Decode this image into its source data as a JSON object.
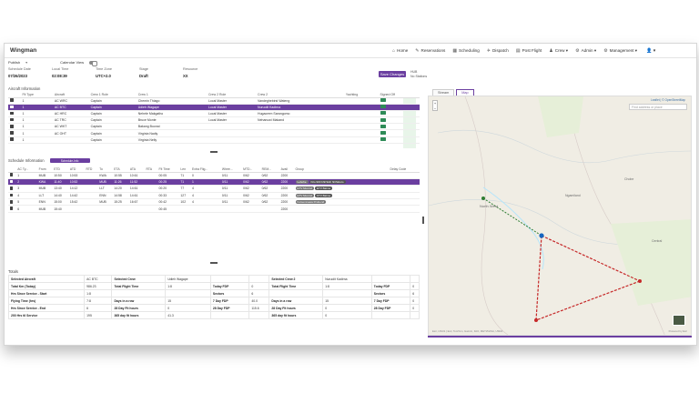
{
  "app": {
    "title": "Wingman"
  },
  "nav": [
    {
      "label": "Home",
      "icon": "home-icon",
      "glyph": "⌂"
    },
    {
      "label": "Reservations",
      "icon": "reservations-icon",
      "glyph": "✎"
    },
    {
      "label": "Scheduling",
      "icon": "scheduling-icon",
      "glyph": "▦"
    },
    {
      "label": "Dispatch",
      "icon": "dispatch-icon",
      "glyph": "✈"
    },
    {
      "label": "Post Flight",
      "icon": "post-flight-icon",
      "glyph": "▤"
    },
    {
      "label": "Crew ▾",
      "icon": "crew-icon",
      "glyph": "♟"
    },
    {
      "label": "Admin ▾",
      "icon": "admin-icon",
      "glyph": "⚙"
    },
    {
      "label": "Management ▾",
      "icon": "management-icon",
      "glyph": "⚙"
    }
  ],
  "user_icon": "👤 ▾",
  "toolbar": {
    "publish_label": "Publish",
    "calendar_view_label": "Calendar View"
  },
  "fields": [
    {
      "label": "Schedule Date",
      "value": "07/26/2023"
    },
    {
      "label": "Local Time",
      "value": "02:08:39"
    },
    {
      "label": "Time Zone",
      "value": "UTC+2.0"
    },
    {
      "label": "Stage",
      "value": "Draft"
    },
    {
      "label": "Resource",
      "value": "XX"
    }
  ],
  "save_label": "Save Changes",
  "side_label": "HUB\nNo Stations",
  "aircraft_section": "Aircraft Information",
  "aircraft_headers": [
    "",
    "Fit Type",
    "Aircraft",
    "Crew 1 Role",
    "Crew 1",
    "",
    "Crew 2 Role",
    "Crew 2",
    "",
    "Yachting",
    "Signed Off"
  ],
  "aircraft_rows": [
    {
      "type": "1",
      "ac": "AC WRC",
      "role1": "Captain",
      "crew1": "Chemin Thiago",
      "role2": "Local Master",
      "crew2": "Vandeghebirst Wateng"
    },
    {
      "type": "1",
      "ac": "AC BTC",
      "role1": "Captain",
      "crew1": "Udieh Wagape",
      "role2": "Local Master",
      "crew2": "Nuruolit Kadirna",
      "selected": true
    },
    {
      "type": "1",
      "ac": "AC HRC",
      "role1": "Captain",
      "crew1": "Nehele Makgatho",
      "role2": "Local Master",
      "crew2": "Hugaorem Sarangomo"
    },
    {
      "type": "1",
      "ac": "AC TRC",
      "role1": "Captain",
      "crew1": "Bruce Monte",
      "role2": "Local Master",
      "crew2": "Nehanuwi Makand"
    },
    {
      "type": "1",
      "ac": "AC WKT",
      "role1": "Captain",
      "crew1": "Bakang Buonai",
      "role2": "",
      "crew2": ""
    },
    {
      "type": "1",
      "ac": "AC OHT",
      "role1": "Captain",
      "crew1": "Virginia Nadiy",
      "role2": "",
      "crew2": ""
    },
    {
      "type": "1",
      "ac": "",
      "role1": "Captain",
      "crew1": "Virginia Nelly",
      "role2": "",
      "crew2": ""
    }
  ],
  "schedule_section": "Schedule Information",
  "schedule_btn": "Schedule-Info",
  "schedule_headers": [
    "",
    "AC Ty...",
    "From",
    "ETD",
    "ATD",
    "RTD",
    "To",
    "ETA",
    "ATA",
    "RTA",
    "Flt Time",
    "Len",
    "Extra Flig...",
    "Whee...",
    "MTD...",
    "REM...",
    "Avail",
    "Group",
    "",
    "Delay Code"
  ],
  "schedule_rows": [
    {
      "n": "1",
      "from": "MUB",
      "etd": "10:50",
      "atd": "10:53",
      "to": "KWA",
      "eta": "10:55",
      "ata": "10:61",
      "flt": "00:05",
      "len": "71",
      "extra": "0",
      "whee": "0/11",
      "mtd": "0/62",
      "rem": "0/62",
      "avail": "2200",
      "pills": []
    },
    {
      "n": "2",
      "from": "KWA",
      "etd": "11:40",
      "atd": "10:52",
      "to": "MUB",
      "eta": "11:26",
      "ata": "11:52",
      "flt": "00:25",
      "len": "71",
      "extra": "1",
      "whee": "0/11",
      "mtd": "0/62",
      "rem": "0/62",
      "avail": "2200",
      "pills": [
        "Lebohe",
        "Kilo 900 bhhSkih hhtSktoto"
      ],
      "selected": true
    },
    {
      "n": "3",
      "from": "MUB",
      "etd": "13:40",
      "atd": "14:12",
      "to": "LLT",
      "eta": "14:20",
      "ata": "14:61",
      "flt": "00:20",
      "len": "77",
      "extra": "4",
      "whee": "0/11",
      "mtd": "0/62",
      "rem": "0/62",
      "avail": "2200",
      "pills": [
        "ETV Musmd",
        "ETV Balme"
      ]
    },
    {
      "n": "4",
      "from": "LLT",
      "etd": "14:40",
      "atd": "14:42",
      "to": "ENN",
      "eta": "14:58",
      "ata": "14:61",
      "flt": "00:33",
      "len": "127",
      "extra": "4",
      "whee": "0/11",
      "mtd": "0/62",
      "rem": "0/62",
      "avail": "2200",
      "pills": [
        "ETV Musmd",
        "KTV Balme"
      ]
    },
    {
      "n": "5",
      "from": "ENN",
      "etd": "15:00",
      "atd": "15:42",
      "to": "MUB",
      "eta": "15:25",
      "ata": "16:67",
      "flt": "00:42",
      "len": "102",
      "extra": "4",
      "whee": "0/11",
      "mtd": "0/62",
      "rem": "0/62",
      "avail": "2200",
      "pills": [
        "Kotsemnawa Rrubend"
      ]
    },
    {
      "n": "6",
      "from": "MUB",
      "etd": "15:40",
      "atd": "",
      "to": "",
      "eta": "",
      "ata": "",
      "flt": "00:45",
      "len": "",
      "extra": "",
      "whee": "",
      "mtd": "",
      "rem": "",
      "avail": "2200",
      "pills": []
    }
  ],
  "totals_section": "Totals",
  "totals_rows": [
    [
      "Selected Aircraft",
      "AC BTC",
      "Selected Crew",
      "Udieh Wagape",
      "",
      "",
      "Selected Crew 2",
      "Nuruolit Kadirna",
      "",
      ""
    ],
    [
      "Total Km (Today)",
      "986.23",
      "Total Flight Time",
      "1:8",
      "Today FDP",
      "0",
      "Total Flight Time",
      "1:8",
      "Today FDP",
      "0"
    ],
    [
      "Hrs Since Service - Start",
      "1:8",
      "",
      "",
      "Sectors",
      "6",
      "",
      "",
      "Sectors",
      "6"
    ],
    [
      "Flying Time (hrs)",
      "7:8",
      "Days in a row",
      "15",
      "7 Day FDP",
      "40.0",
      "Days in a row",
      "15",
      "7 Day FDP",
      "0"
    ],
    [
      "Hrs Since Service - End",
      "6",
      "28 Day Fit hours",
      "0",
      "28 Day FDP",
      "115.6",
      "28 Day Fit hours",
      "0",
      "28 Day FDP",
      "0"
    ],
    [
      "200 Hrs til Service",
      "195",
      "365 day fit hours",
      "41.3",
      "",
      "",
      "365 day fit hours",
      "0",
      "",
      ""
    ]
  ],
  "map": {
    "tabs": [
      "Stream",
      "Map"
    ],
    "active_tab": "Map",
    "search_placeholder": "Find address or place",
    "link": "Leaflet | © OpenStreetMap",
    "attribution": "Esri, USGS | Esri, TomTom, Garmin, FAO, METI/NASA, USDA",
    "powered_by": "Powered by Esri",
    "labels": [
      "North West",
      "Ngamiland",
      "Chobe",
      "Central"
    ],
    "route_color": "#c62828",
    "route_color_active": "#2e7d32"
  },
  "colors": {
    "accent": "#6b3fa0",
    "signed": "#2e8b57"
  }
}
